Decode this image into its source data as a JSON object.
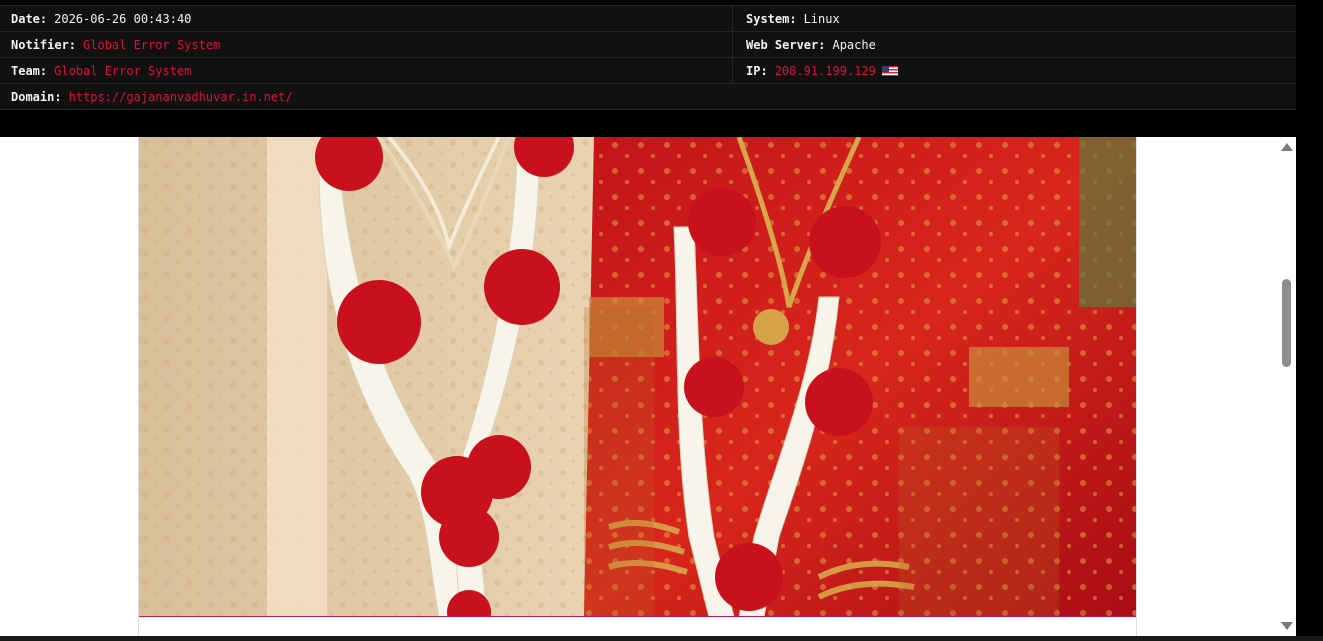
{
  "info": {
    "date": {
      "label": "Date:",
      "value": "2026-06-26 00:43:40"
    },
    "system": {
      "label": "System:",
      "value": "Linux"
    },
    "notifier": {
      "label": "Notifier:",
      "value": "Global Error System"
    },
    "web_server": {
      "label": "Web Server:",
      "value": "Apache"
    },
    "team": {
      "label": "Team:",
      "value": "Global Error System"
    },
    "ip": {
      "label": "IP:",
      "value": "208.91.199.129",
      "flag": "us-flag-icon"
    },
    "domain": {
      "label": "Domain:",
      "value": "https://gajananvadhuvar.in.net/"
    }
  },
  "colors": {
    "accent_red": "#d4143a",
    "panel_bg": "#111111"
  },
  "preview": {
    "image": "wedding-couple-garlands-photo"
  },
  "scrollbar": {
    "up_icon": "scroll-up-arrow-icon",
    "down_icon": "scroll-down-arrow-icon"
  }
}
